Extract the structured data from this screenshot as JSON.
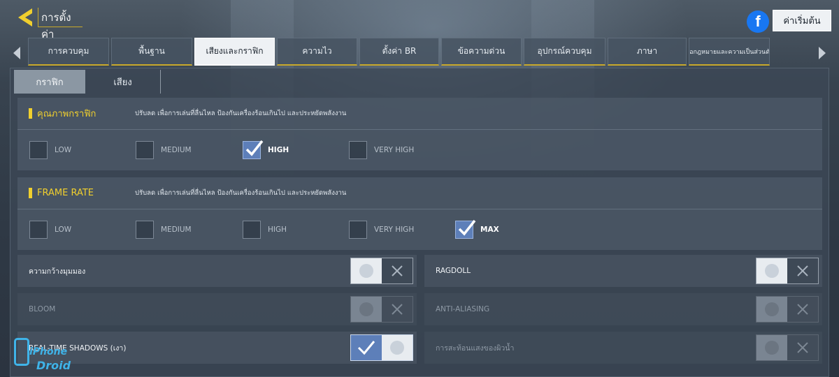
{
  "header": {
    "title": "การตั้งค่า",
    "reset_label": "ค่าเริ่มต้น",
    "facebook_glyph": "f"
  },
  "tabs": [
    {
      "label": "การควบคุม",
      "active": false
    },
    {
      "label": "พื้นฐาน",
      "active": false
    },
    {
      "label": "เสียงและกราฟิก",
      "active": true
    },
    {
      "label": "ความไว",
      "active": false
    },
    {
      "label": "ตั้งค่า BR",
      "active": false
    },
    {
      "label": "ข้อความด่วน",
      "active": false
    },
    {
      "label": "อุปกรณ์ควบคุม",
      "active": false
    },
    {
      "label": "ภาษา",
      "active": false
    },
    {
      "label": "ข้อกฎหมายและความเป็นส่วนตัว",
      "active": false
    }
  ],
  "subtabs": [
    {
      "label": "กราฟิก",
      "active": true
    },
    {
      "label": "เสียง",
      "active": false
    }
  ],
  "graphics_quality": {
    "title": "คุณภาพกราฟิก",
    "description": "ปรับลด เพื่อการเล่นที่ลื่นไหล ป้องกันเครื่องร้อนเกินไป และประหยัดพลังงาน",
    "options": [
      {
        "label": "LOW",
        "checked": false
      },
      {
        "label": "MEDIUM",
        "checked": false
      },
      {
        "label": "HIGH",
        "checked": true
      },
      {
        "label": "VERY HIGH",
        "checked": false
      }
    ]
  },
  "frame_rate": {
    "title": "FRAME RATE",
    "description": "ปรับลด เพื่อการเล่นที่ลื่นไหล ป้องกันเครื่องร้อนเกินไป และประหยัดพลังงาน",
    "options": [
      {
        "label": "LOW",
        "checked": false
      },
      {
        "label": "MEDIUM",
        "checked": false
      },
      {
        "label": "HIGH",
        "checked": false
      },
      {
        "label": "VERY HIGH",
        "checked": false
      },
      {
        "label": "MAX",
        "checked": true
      }
    ]
  },
  "toggles": [
    {
      "label": "ความกว้างมุมมอง",
      "state": "off",
      "enabled": true
    },
    {
      "label": "RAGDOLL",
      "state": "off",
      "enabled": true
    },
    {
      "label": "BLOOM",
      "state": "off",
      "enabled": false
    },
    {
      "label": "ANTI-ALIASING",
      "state": "off",
      "enabled": false
    },
    {
      "label": "REAL-TIME SHADOWS (เงา)",
      "state": "on",
      "enabled": true
    },
    {
      "label": "การสะท้อนแสงของผิวน้ำ",
      "state": "off",
      "enabled": false
    }
  ],
  "watermark": {
    "line1": "iPhone",
    "line2": "Droid"
  },
  "colors": {
    "accent_gold": "#f0cf2e",
    "checked_blue": "#5d7fb9",
    "facebook_blue": "#1877f2"
  }
}
